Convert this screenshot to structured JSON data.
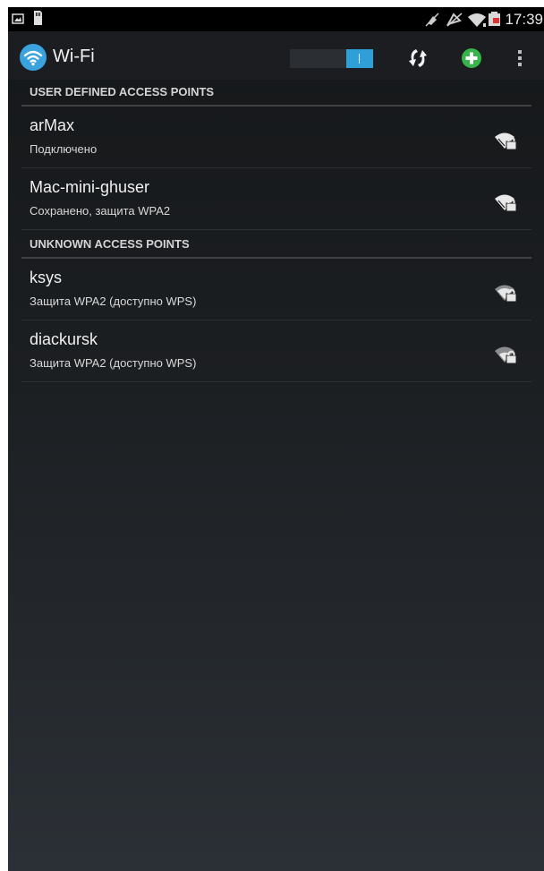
{
  "status_bar": {
    "time": "17:39",
    "left_icons": [
      "gallery-notification-icon",
      "sd-card-icon"
    ],
    "right_icons": [
      "mute-icon",
      "no-sound-icon",
      "wifi-status-icon",
      "battery-icon"
    ]
  },
  "action_bar": {
    "title": "Wi-Fi",
    "toggle_on": true,
    "accent": "#2f9fd7"
  },
  "sections": [
    {
      "header": "USER DEFINED ACCESS POINTS",
      "networks": [
        {
          "ssid": "arMax",
          "status": "Подключено",
          "signal": "wifi-lock-icon"
        },
        {
          "ssid": "Mac-mini-ghuser",
          "status": "Сохранено, защита WPA2",
          "signal": "wifi-lock-icon"
        }
      ]
    },
    {
      "header": "UNKNOWN ACCESS POINTS",
      "networks": [
        {
          "ssid": "ksys",
          "status": "Защита WPA2 (доступно WPS)",
          "signal": "wifi-lock-icon"
        },
        {
          "ssid": "diackursk",
          "status": "Защита WPA2 (доступно WPS)",
          "signal": "wifi-lock-icon"
        }
      ]
    }
  ]
}
